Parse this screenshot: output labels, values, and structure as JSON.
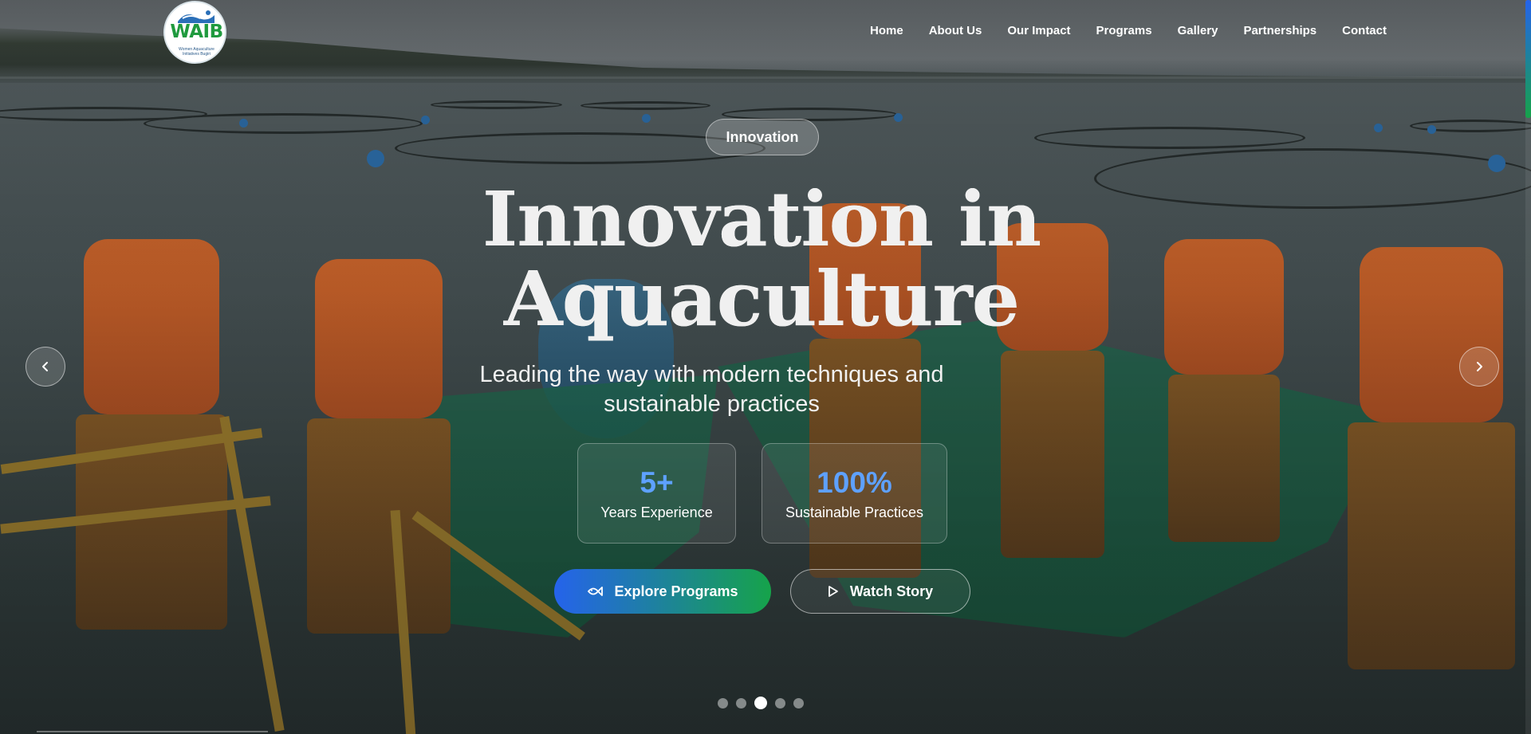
{
  "brand": {
    "logo_text": "WAIB",
    "logo_subtext": "Women Aquaculture Initiatives Bugiri"
  },
  "nav": {
    "items": [
      {
        "label": "Home"
      },
      {
        "label": "About Us"
      },
      {
        "label": "Our Impact"
      },
      {
        "label": "Programs"
      },
      {
        "label": "Gallery"
      },
      {
        "label": "Partnerships"
      },
      {
        "label": "Contact"
      }
    ]
  },
  "hero": {
    "badge": "Innovation",
    "title_line1": "Innovation in",
    "title_line2": "Aquaculture",
    "subtitle": "Leading the way with modern techniques and sustainable practices",
    "stats": [
      {
        "value": "5+",
        "label": "Years Experience"
      },
      {
        "value": "100%",
        "label": "Sustainable Practices"
      }
    ],
    "primary_button": "Explore Programs",
    "secondary_button": "Watch Story",
    "slides_total": 5,
    "active_slide": 3
  },
  "colors": {
    "accent_blue": "#2563eb",
    "accent_green": "#16a34a",
    "stat_value": "#5ea1ff"
  },
  "icons": {
    "primary_button_icon": "fish-icon",
    "secondary_button_icon": "play-icon",
    "prev": "chevron-left-icon",
    "next": "chevron-right-icon"
  }
}
